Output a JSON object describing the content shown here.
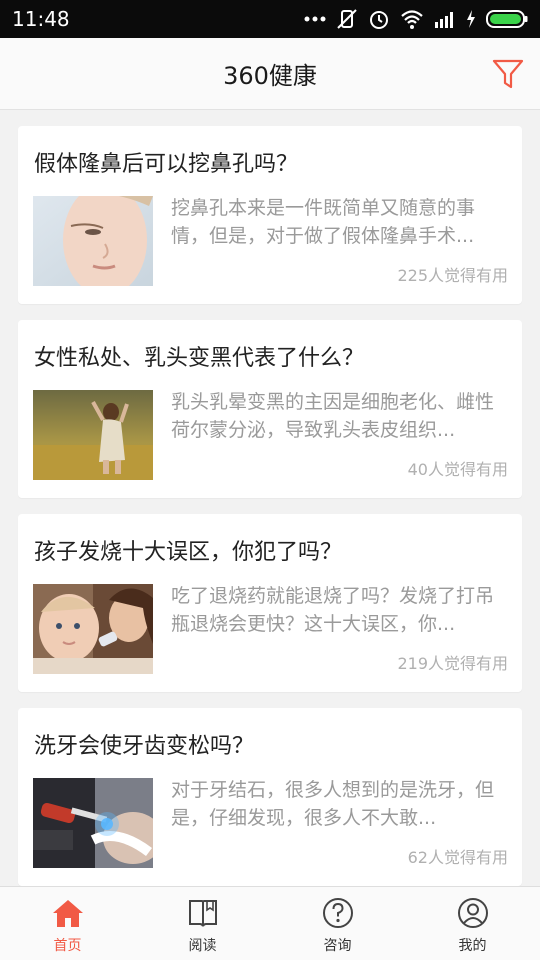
{
  "status_bar": {
    "time": "11:48",
    "icons": [
      "more-dots-icon",
      "vibrate-off-icon",
      "alarm-icon",
      "wifi-icon",
      "signal-icon",
      "charging-icon",
      "battery-icon"
    ]
  },
  "header": {
    "title": "360健康",
    "filter_icon": "filter-icon"
  },
  "articles": [
    {
      "title": "假体隆鼻后可以挖鼻孔吗？",
      "summary": "挖鼻孔本来是一件既简单又随意的事情，但是，对于做了假体隆鼻手术...",
      "likes": "225人觉得有用",
      "thumb": "woman-face"
    },
    {
      "title": "女性私处、乳头变黑代表了什么？",
      "summary": "乳头乳晕变黑的主因是细胞老化、雌性荷尔蒙分泌，导致乳头表皮组织...",
      "likes": "40人觉得有用",
      "thumb": "woman-in-field"
    },
    {
      "title": "孩子发烧十大误区，你犯了吗？",
      "summary": "吃了退烧药就能退烧了吗？发烧了打吊瓶退烧会更快？这十大误区，你...",
      "likes": "219人觉得有用",
      "thumb": "mother-and-baby"
    },
    {
      "title": "洗牙会使牙齿变松吗？",
      "summary": "对于牙结石，很多人想到的是洗牙，但是，仔细发现，很多人不大敢...",
      "likes": "62人觉得有用",
      "thumb": "dental-treatment"
    }
  ],
  "tabs": [
    {
      "label": "首页",
      "icon": "home-icon",
      "active": true
    },
    {
      "label": "阅读",
      "icon": "book-icon",
      "active": false
    },
    {
      "label": "咨询",
      "icon": "question-icon",
      "active": false
    },
    {
      "label": "我的",
      "icon": "user-icon",
      "active": false
    }
  ],
  "colors": {
    "accent": "#f15a45",
    "background": "#f2f2f2",
    "card": "#ffffff",
    "summary_text": "#9a9a9a"
  }
}
